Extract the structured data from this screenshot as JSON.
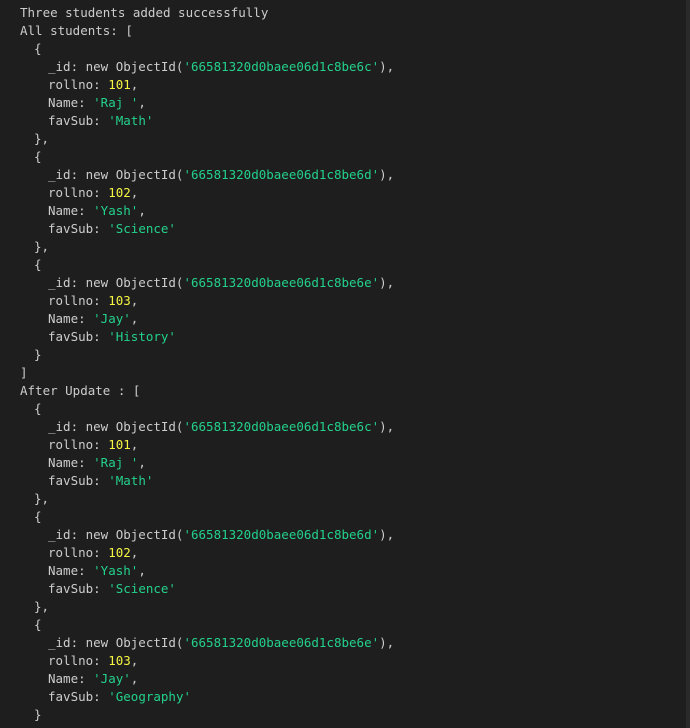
{
  "terminal": {
    "status_message": "Three students added successfully",
    "sections": [
      {
        "heading": "All students: [",
        "records": [
          {
            "id": "'66581320d0baee06d1c8be6c'",
            "rollno": "101",
            "name": "'Raj '",
            "favSub": "'Math'",
            "close": "},"
          },
          {
            "id": "'66581320d0baee06d1c8be6d'",
            "rollno": "102",
            "name": "'Yash'",
            "favSub": "'Science'",
            "close": "},"
          },
          {
            "id": "'66581320d0baee06d1c8be6e'",
            "rollno": "103",
            "name": "'Jay'",
            "favSub": "'History'",
            "close": "}"
          }
        ],
        "end": "]"
      },
      {
        "heading": "After Update : [",
        "records": [
          {
            "id": "'66581320d0baee06d1c8be6c'",
            "rollno": "101",
            "name": "'Raj '",
            "favSub": "'Math'",
            "close": "},"
          },
          {
            "id": "'66581320d0baee06d1c8be6d'",
            "rollno": "102",
            "name": "'Yash'",
            "favSub": "'Science'",
            "close": "},"
          },
          {
            "id": "'66581320d0baee06d1c8be6e'",
            "rollno": "103",
            "name": "'Jay'",
            "favSub": "'Geography'",
            "close": "}"
          }
        ]
      }
    ],
    "tokens": {
      "open_brace": "{",
      "id_key": "_id: new ObjectId(",
      "id_tail": "),",
      "rollno_key": "rollno: ",
      "name_key": "Name: ",
      "favsub_key": "favSub: ",
      "comma": ","
    }
  },
  "colors": {
    "background": "#1e1e1e",
    "text": "#cccccc",
    "string": "#23d18b",
    "number": "#f5f543"
  }
}
